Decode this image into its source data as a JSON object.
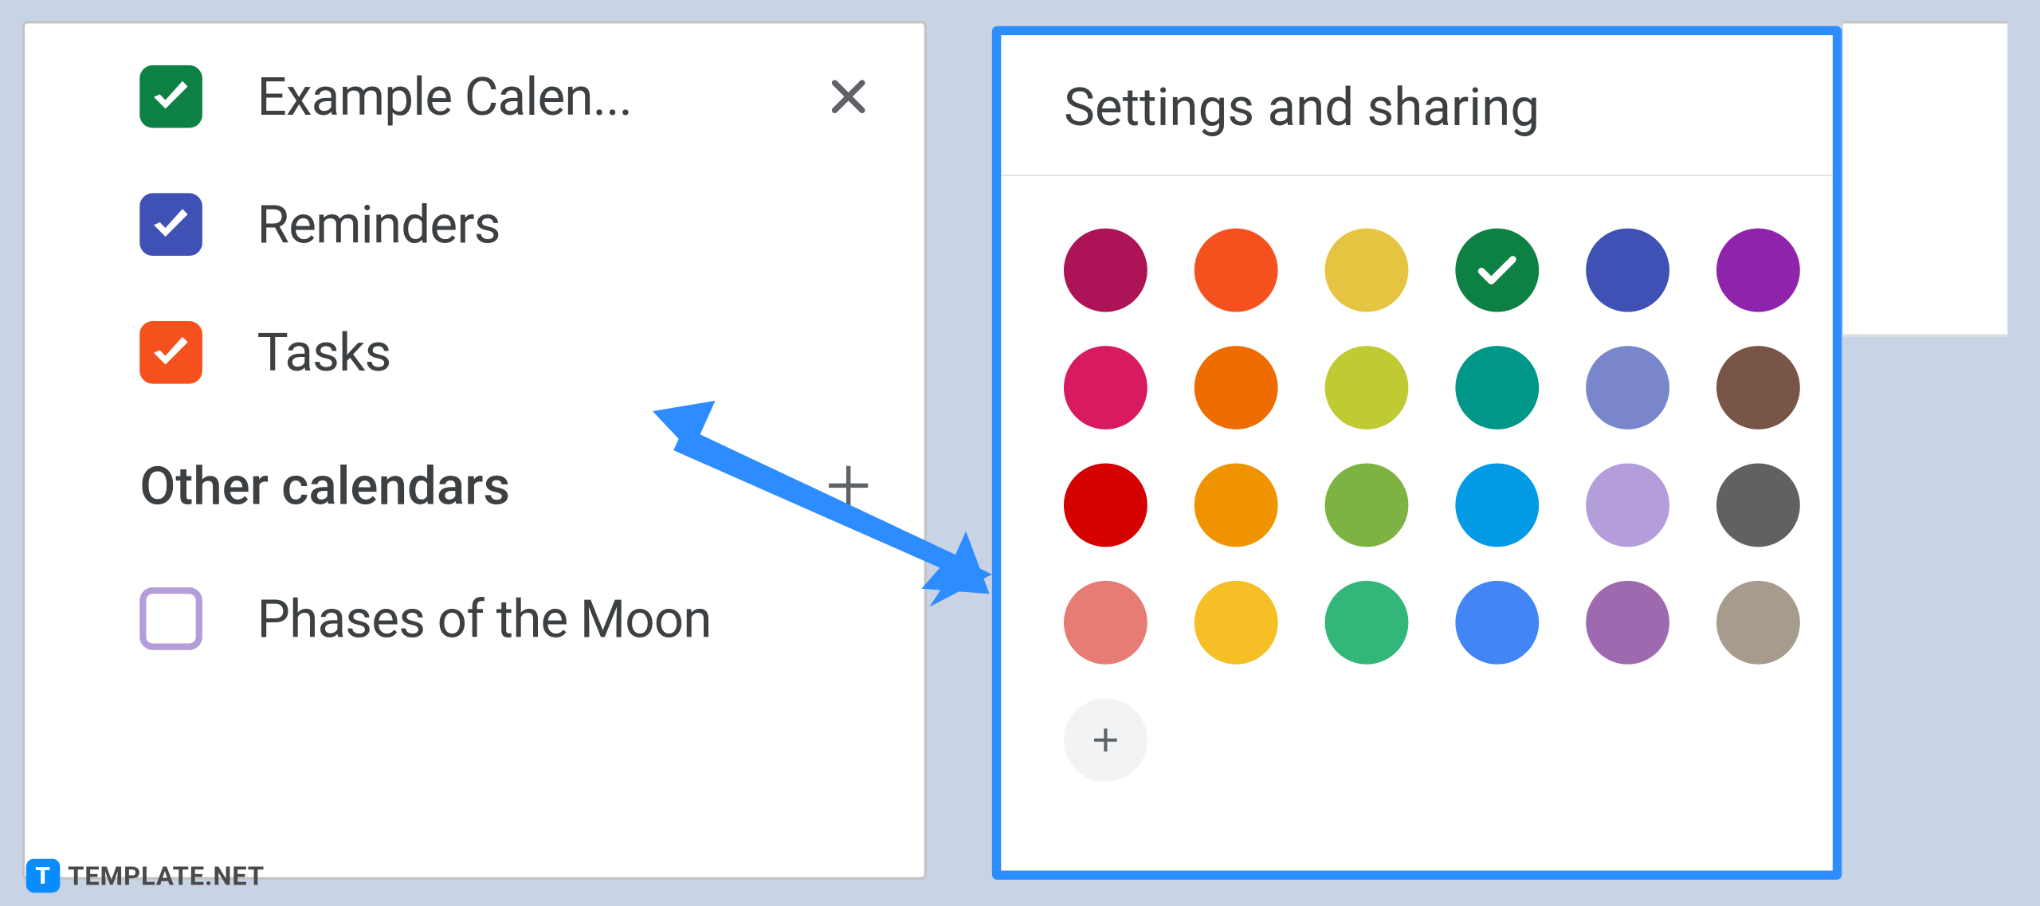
{
  "sidebar": {
    "calendars": [
      {
        "label": "Example Calen...",
        "checked": true,
        "color": "#0d8043",
        "showClose": true
      },
      {
        "label": "Reminders",
        "checked": true,
        "color": "#3f51b5",
        "showClose": false
      },
      {
        "label": "Tasks",
        "checked": true,
        "color": "#f4511e",
        "showClose": false
      }
    ],
    "section_title": "Other calendars",
    "other": [
      {
        "label": "Phases of the Moon",
        "checked": false,
        "color": "#b39ddb"
      }
    ]
  },
  "popover": {
    "title": "Settings and sharing",
    "selected_color": "#0d8043",
    "colors": [
      "#ad1457",
      "#f4511e",
      "#e4c441",
      "#0d8043",
      "#3f51b5",
      "#8e24aa",
      "#d81b60",
      "#ef6c00",
      "#c0ca33",
      "#009688",
      "#7986cb",
      "#795548",
      "#d50000",
      "#f09300",
      "#7cb342",
      "#039be5",
      "#b39ddb",
      "#616161",
      "#e67c73",
      "#f6bf26",
      "#33b679",
      "#4285f4",
      "#9e69af",
      "#a79b8e"
    ]
  },
  "watermark": {
    "text": "TEMPLATE.NET"
  }
}
